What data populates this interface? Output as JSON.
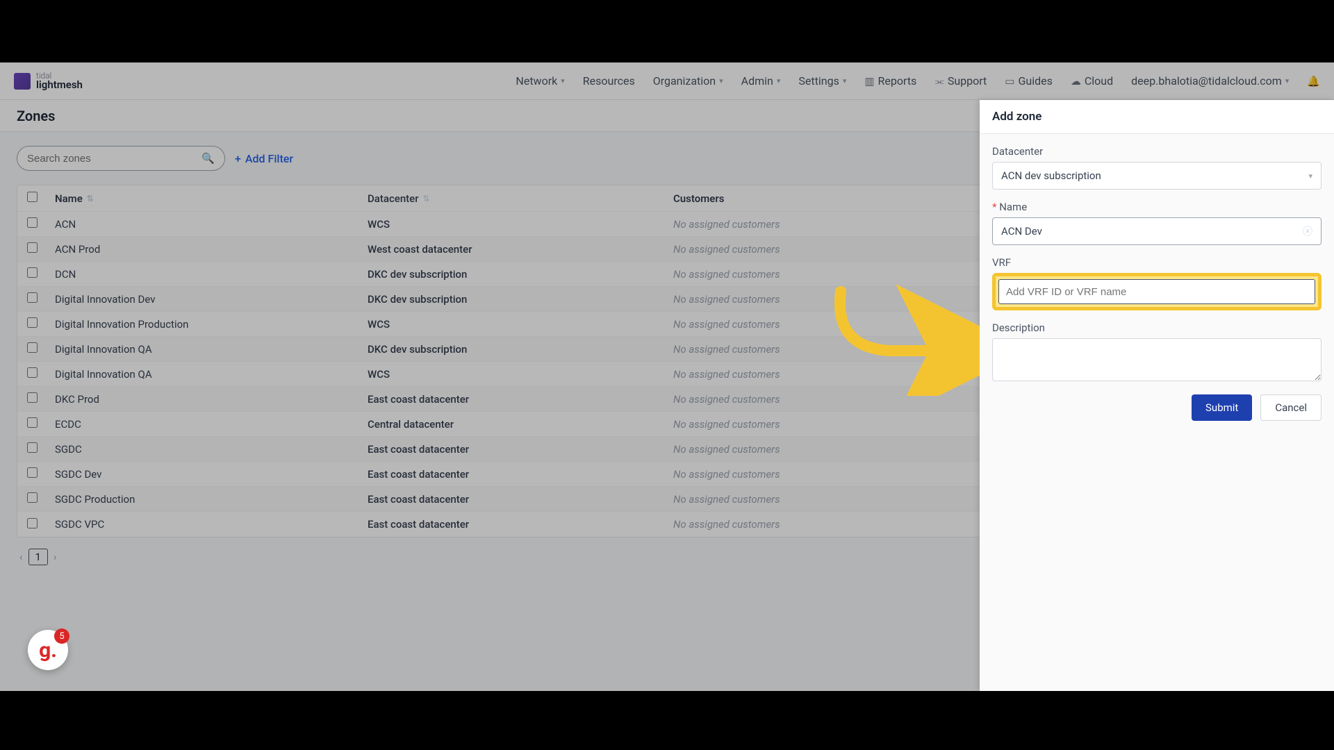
{
  "brand": {
    "top": "tidal",
    "bottom": "lightmesh"
  },
  "nav": {
    "network": "Network",
    "resources": "Resources",
    "organization": "Organization",
    "admin": "Admin",
    "settings": "Settings",
    "reports": "Reports",
    "support": "Support",
    "guides": "Guides",
    "cloud": "Cloud",
    "user": "deep.bhalotia@tidalcloud.com"
  },
  "page": {
    "title": "Zones"
  },
  "filter": {
    "search_placeholder": "Search zones",
    "add_filter": "Add Filter"
  },
  "columns": {
    "name": "Name",
    "datacenter": "Datacenter",
    "customers": "Customers"
  },
  "no_customers": "No assigned customers",
  "rows": [
    {
      "name": "ACN",
      "dc": "WCS"
    },
    {
      "name": "ACN Prod",
      "dc": "West coast datacenter"
    },
    {
      "name": "DCN",
      "dc": "DKC dev subscription"
    },
    {
      "name": "Digital Innovation Dev",
      "dc": "DKC dev subscription"
    },
    {
      "name": "Digital Innovation Production",
      "dc": "WCS"
    },
    {
      "name": "Digital Innovation QA",
      "dc": "DKC dev subscription"
    },
    {
      "name": "Digital Innovation QA",
      "dc": "WCS"
    },
    {
      "name": "DKC Prod",
      "dc": "East coast datacenter"
    },
    {
      "name": "ECDC",
      "dc": "Central datacenter"
    },
    {
      "name": "SGDC",
      "dc": "East coast datacenter"
    },
    {
      "name": "SGDC Dev",
      "dc": "East coast datacenter"
    },
    {
      "name": "SGDC Production",
      "dc": "East coast datacenter"
    },
    {
      "name": "SGDC VPC",
      "dc": "East coast datacenter"
    }
  ],
  "pagination": {
    "page": "1"
  },
  "panel": {
    "title": "Add zone",
    "labels": {
      "datacenter": "Datacenter",
      "name": "Name",
      "vrf": "VRF",
      "description": "Description"
    },
    "values": {
      "datacenter": "ACN dev subscription",
      "name": "ACN Dev"
    },
    "vrf_placeholder": "Add VRF ID or VRF name",
    "submit": "Submit",
    "cancel": "Cancel"
  },
  "fab": {
    "badge": "5"
  }
}
